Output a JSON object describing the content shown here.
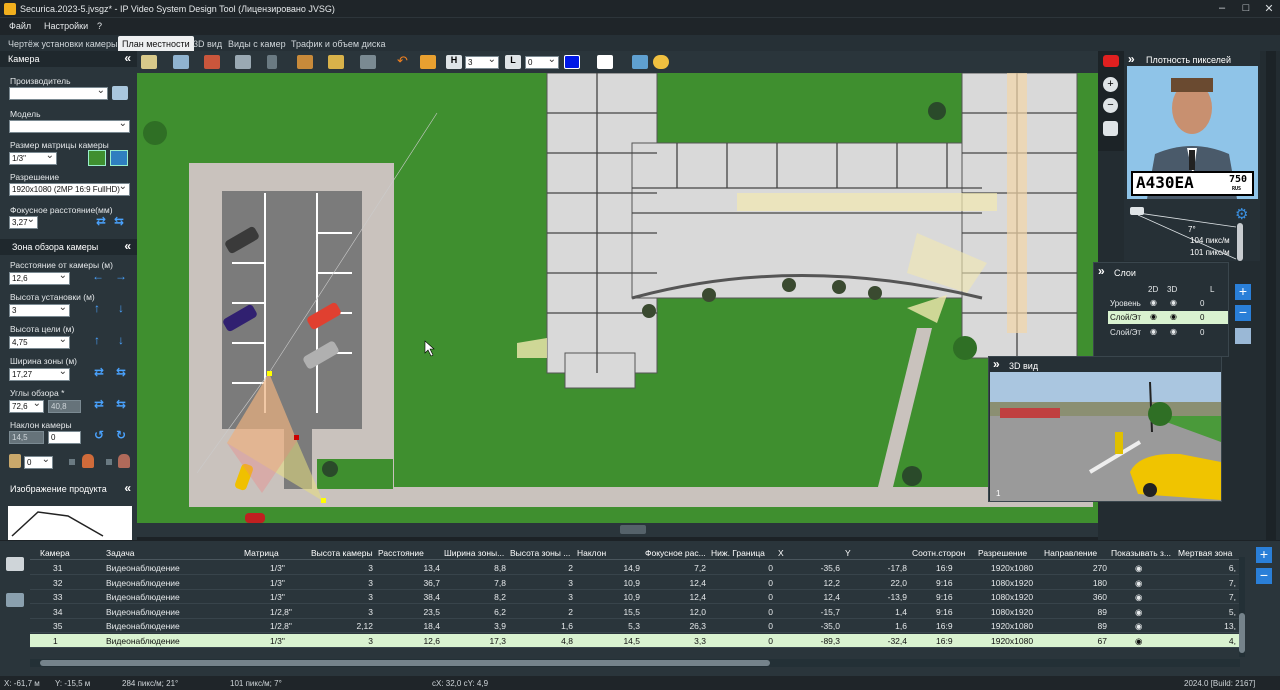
{
  "window": {
    "title": "Securica.2023-5.jvsgz* - IP Video System Design Tool (Лицензировано JVSG)"
  },
  "menu": [
    "Файл",
    "Настройки",
    "?"
  ],
  "tabs": [
    "Чертёж установки камеры",
    "План местности",
    "3D вид",
    "Виды с камер",
    "Трафик и объем диска"
  ],
  "active_tab": 1,
  "camera_panel": {
    "header": "Камера",
    "manufacturer_label": "Производитель",
    "manufacturer_value": "",
    "model_label": "Модель",
    "model_value": "",
    "sensor_label": "Размер матрицы камеры",
    "sensor_value": "1/3\"",
    "resolution_label": "Разрешение",
    "resolution_value": "1920x1080 (2MP 16:9 FullHD)",
    "focal_label": "Фокусное расстояние(мм)",
    "focal_value": "3,27"
  },
  "zone_panel": {
    "header": "Зона обзора камеры",
    "distance_label": "Расстояние от камеры (м)",
    "distance_value": "12,6",
    "height_label": "Высота установки (м)",
    "height_value": "3",
    "target_label": "Высота цели (м)",
    "target_value": "4,75",
    "width_label": "Ширина зоны (м)",
    "width_value": "17,27",
    "angles_label": "Углы обзора *",
    "angle_h": "72,6",
    "angle_v": "40,8",
    "tilt_label": "Наклон камеры",
    "tilt_a": "14,5",
    "tilt_b": "0",
    "small_select": "0"
  },
  "product_panel": {
    "header": "Изображение продукта"
  },
  "toolbar": {
    "h_value": "3",
    "l_value": "0",
    "color_accent": "#0018e6"
  },
  "density_panel": {
    "header": "Плотность пикселей",
    "plate": "А430ЕА",
    "plate_region": "750",
    "plate_country": "RUS",
    "angle": "7°",
    "line1": "104 пикс/м",
    "line2": "101 пикс/м"
  },
  "layers_panel": {
    "header": "Слои",
    "col_2d": "2D",
    "col_3d": "3D",
    "col_l": "L",
    "rows": [
      {
        "name": "Уровень",
        "count": "0"
      },
      {
        "name": "Слой/Эт",
        "count": "0"
      },
      {
        "name": "Слой/Эт",
        "count": "0"
      }
    ]
  },
  "view3d_panel": {
    "header": "3D вид",
    "index": "1"
  },
  "table": {
    "headers": [
      "Камера",
      "Задача",
      "Матрица",
      "Высота камеры",
      "Расстояние",
      "Ширина зоны...",
      "Высота зоны ...",
      "Наклон",
      "Фокусное рас...",
      "Ниж. Граница",
      "X",
      "Y",
      "Соотн.сторон",
      "Разрешение",
      "Направление",
      "Показывать з...",
      "Мертвая зона"
    ],
    "rows": [
      [
        "31",
        "Видеонаблюдение",
        "1/3\"",
        "3",
        "13,4",
        "8,8",
        "2",
        "14,9",
        "7,2",
        "0",
        "-35,6",
        "-17,8",
        "16:9",
        "1920x1080",
        "270",
        "6,"
      ],
      [
        "32",
        "Видеонаблюдение",
        "1/3\"",
        "3",
        "36,7",
        "7,8",
        "3",
        "10,9",
        "12,4",
        "0",
        "12,2",
        "22,0",
        "9:16",
        "1080x1920",
        "180",
        "7,"
      ],
      [
        "33",
        "Видеонаблюдение",
        "1/3\"",
        "3",
        "38,4",
        "8,2",
        "3",
        "10,9",
        "12,4",
        "0",
        "12,4",
        "-13,9",
        "9:16",
        "1080x1920",
        "360",
        "7,"
      ],
      [
        "34",
        "Видеонаблюдение",
        "1/2,8\"",
        "3",
        "23,5",
        "6,2",
        "2",
        "15,5",
        "12,0",
        "0",
        "-15,7",
        "1,4",
        "9:16",
        "1080x1920",
        "89",
        "5,"
      ],
      [
        "35",
        "Видеонаблюдение",
        "1/2,8\"",
        "2,12",
        "18,4",
        "3,9",
        "1,6",
        "5,3",
        "26,3",
        "0",
        "-35,0",
        "1,6",
        "16:9",
        "1920x1080",
        "89",
        "13,"
      ],
      [
        "1",
        "Видеонаблюдение",
        "1/3\"",
        "3",
        "12,6",
        "17,3",
        "4,8",
        "14,5",
        "3,3",
        "0",
        "-89,3",
        "-32,4",
        "16:9",
        "1920x1080",
        "67",
        "4,"
      ]
    ],
    "selected_row": 5
  },
  "status": {
    "x": "X: -61,7 м",
    "y": "Y: -15,5 м",
    "density1": "284 пикс/м; 21°",
    "density2": "101 пикс/м; 7°",
    "cursor": "cX: 32,0 cY: 4,9",
    "build": "2024.0 [Build: 2167]"
  }
}
